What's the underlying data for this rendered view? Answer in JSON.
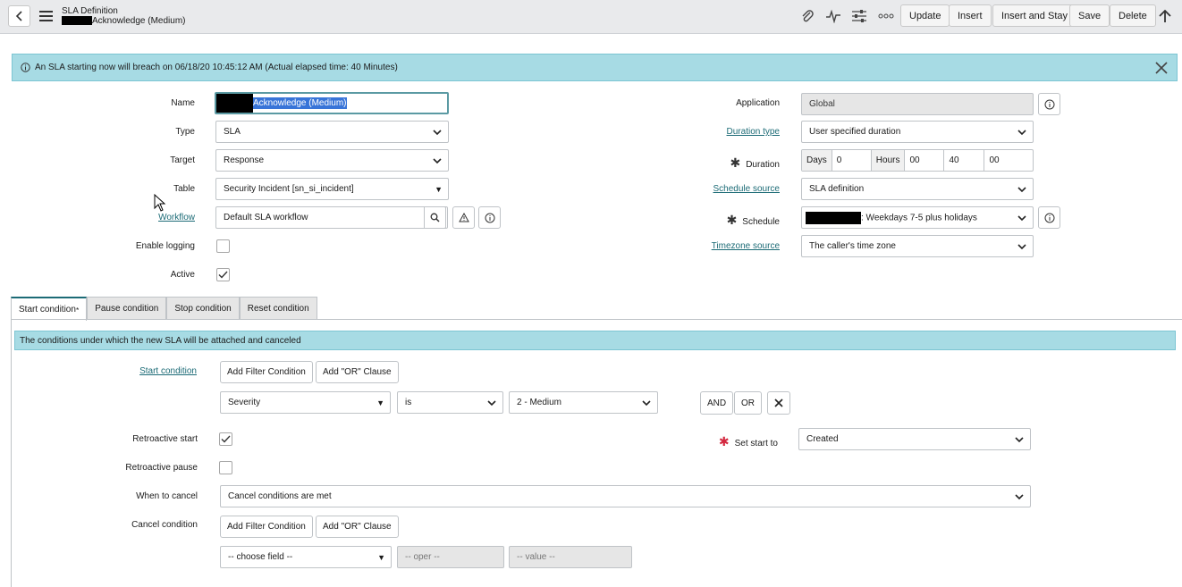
{
  "header": {
    "record_type": "SLA Definition",
    "record_name": "Acknowledge (Medium)",
    "buttons": {
      "update": "Update",
      "insert": "Insert",
      "insert_stay": "Insert and Stay",
      "save": "Save",
      "delete": "Delete"
    },
    "icons": [
      "back-icon",
      "menu-icon",
      "paperclip-icon",
      "activity-icon",
      "settings-sliders-icon",
      "more-icon",
      "scroll-up-icon"
    ]
  },
  "banner": {
    "message": "An SLA starting now will breach on 06/18/20 10:45:12 AM (Actual elapsed time: 40 Minutes)"
  },
  "form": {
    "name": {
      "label": "Name",
      "value": "Acknowledge (Medium)"
    },
    "type": {
      "label": "Type",
      "value": "SLA"
    },
    "target": {
      "label": "Target",
      "value": "Response"
    },
    "table": {
      "label": "Table",
      "value": "Security Incident [sn_si_incident]"
    },
    "workflow": {
      "label": "Workflow",
      "value": "Default SLA workflow"
    },
    "enable_logging": {
      "label": "Enable logging",
      "checked": false
    },
    "active": {
      "label": "Active",
      "checked": true
    },
    "application": {
      "label": "Application",
      "value": "Global"
    },
    "duration_type": {
      "label": "Duration type",
      "value": "User specified duration"
    },
    "duration": {
      "label": "Duration",
      "days_label": "Days",
      "days": "0",
      "hours_label": "Hours",
      "hours": "00",
      "minutes": "40",
      "seconds": "00"
    },
    "schedule_source": {
      "label": "Schedule source",
      "value": "SLA definition"
    },
    "schedule": {
      "label": "Schedule",
      "value": ": Weekdays 7-5 plus holidays"
    },
    "timezone_source": {
      "label": "Timezone source",
      "value": "The caller's time zone"
    }
  },
  "tabs": [
    {
      "label": "Start condition",
      "active": true,
      "marker": "*"
    },
    {
      "label": "Pause condition",
      "active": false
    },
    {
      "label": "Stop condition",
      "active": false
    },
    {
      "label": "Reset condition",
      "active": false
    }
  ],
  "start_panel": {
    "info": "The conditions under which the new SLA will be attached and canceled",
    "start_condition_label": "Start condition",
    "add_filter": "Add Filter Condition",
    "add_or": "Add \"OR\" Clause",
    "condition": {
      "field": "Severity",
      "operator": "is",
      "value": "2 - Medium",
      "and": "AND",
      "or": "OR"
    },
    "retroactive_start": {
      "label": "Retroactive start",
      "checked": true
    },
    "retroactive_pause": {
      "label": "Retroactive pause",
      "checked": false
    },
    "set_start_to": {
      "label": "Set start to",
      "value": "Created"
    },
    "when_to_cancel": {
      "label": "When to cancel",
      "value": "Cancel conditions are met"
    },
    "cancel_condition": {
      "label": "Cancel condition",
      "add_filter": "Add Filter Condition",
      "add_or": "Add \"OR\" Clause",
      "field_placeholder": "-- choose field --",
      "oper_placeholder": "-- oper --",
      "value_placeholder": "-- value --"
    }
  }
}
